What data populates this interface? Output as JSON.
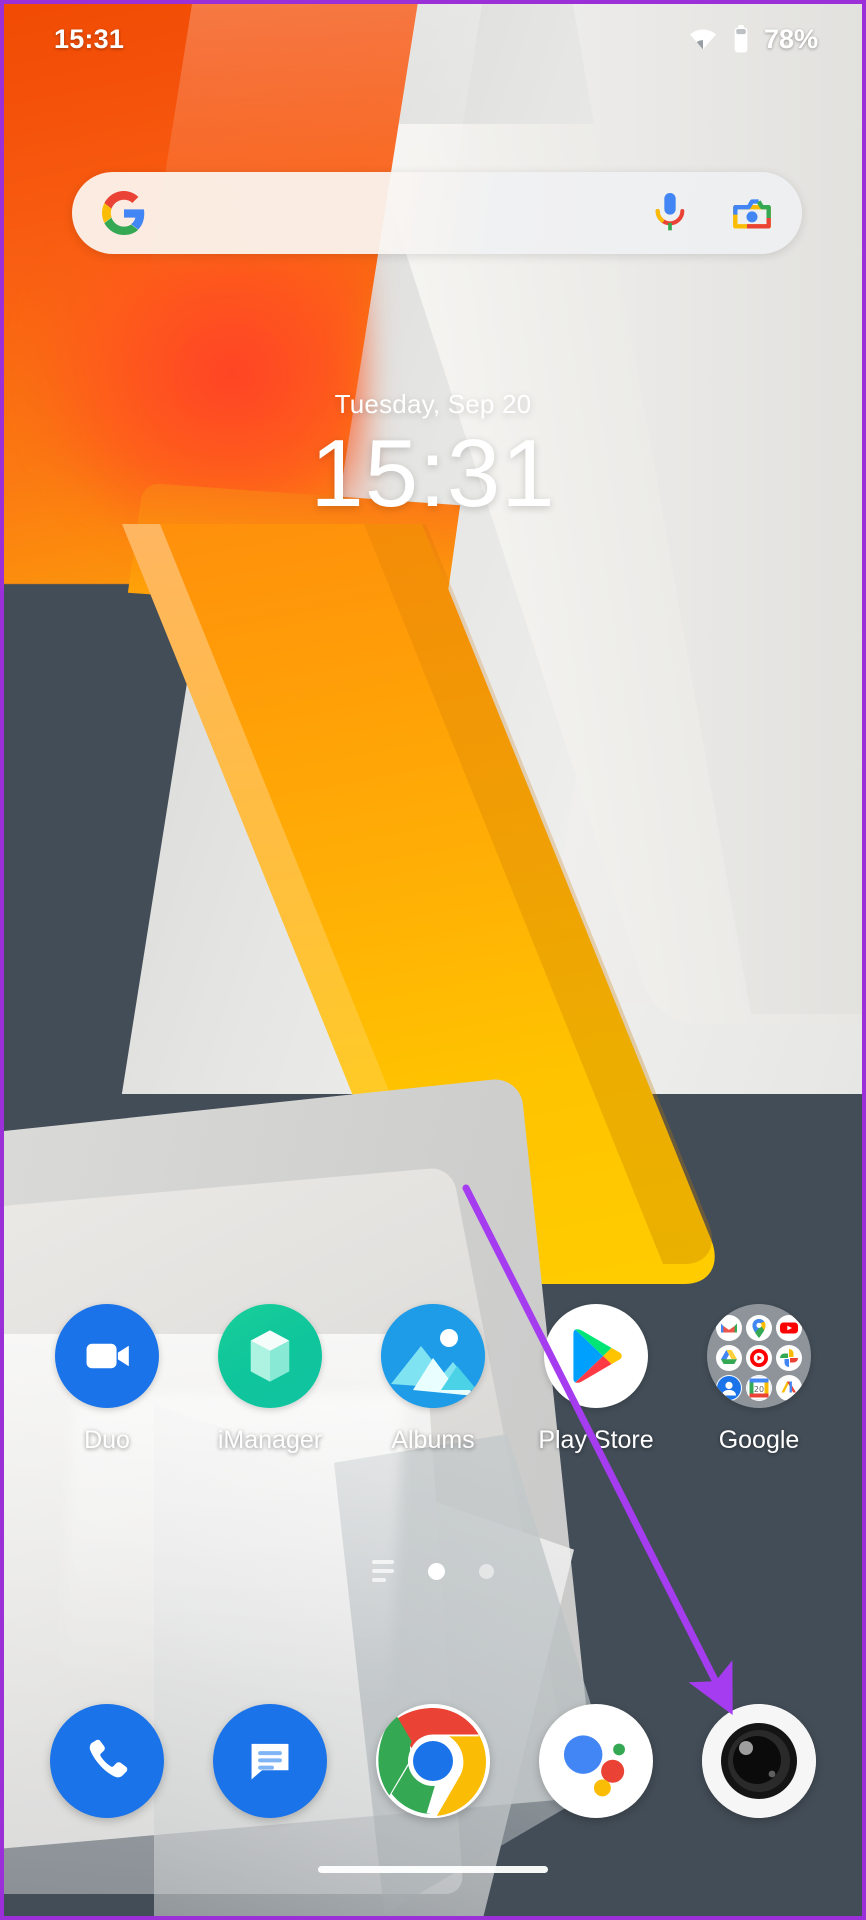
{
  "status_bar": {
    "time": "15:31",
    "battery_percent": "78%",
    "wifi_icon": "wifi-icon",
    "battery_icon": "battery-icon"
  },
  "search": {
    "google_logo": "google-g-logo",
    "mic_icon": "microphone-icon",
    "lens_icon": "google-lens-camera-icon",
    "placeholder": ""
  },
  "clock_widget": {
    "date": "Tuesday, Sep 20",
    "time": "15:31"
  },
  "apps": [
    {
      "label": "Duo",
      "icon": "duo-icon"
    },
    {
      "label": "iManager",
      "icon": "imanager-icon"
    },
    {
      "label": "Albums",
      "icon": "albums-icon"
    },
    {
      "label": "Play Store",
      "icon": "play-store-icon"
    },
    {
      "label": "Google",
      "icon": "google-folder-icon"
    }
  ],
  "google_folder_apps": [
    "gmail-icon",
    "maps-icon",
    "youtube-icon",
    "drive-icon",
    "youtube-music-icon",
    "photos-icon",
    "contacts-icon",
    "calendar-icon",
    "google-one-icon"
  ],
  "page_indicator": {
    "pages": 2,
    "active_index": 0,
    "menu_icon": "page-list-icon"
  },
  "dock": [
    {
      "label": "Phone",
      "icon": "phone-icon"
    },
    {
      "label": "Messages",
      "icon": "messages-icon"
    },
    {
      "label": "Chrome",
      "icon": "chrome-icon"
    },
    {
      "label": "Assistant",
      "icon": "google-assistant-icon"
    },
    {
      "label": "Camera",
      "icon": "camera-icon"
    }
  ],
  "annotation": {
    "arrow_color": "#a63cf0",
    "points_to": "camera-icon"
  },
  "colors": {
    "frame_border": "#9b30d9",
    "wallpaper_dark": "#434d57",
    "accent_orange": "#f95f12",
    "accent_yellow": "#ffc300"
  },
  "home_indicator": {
    "label": "home-gesture-bar"
  }
}
